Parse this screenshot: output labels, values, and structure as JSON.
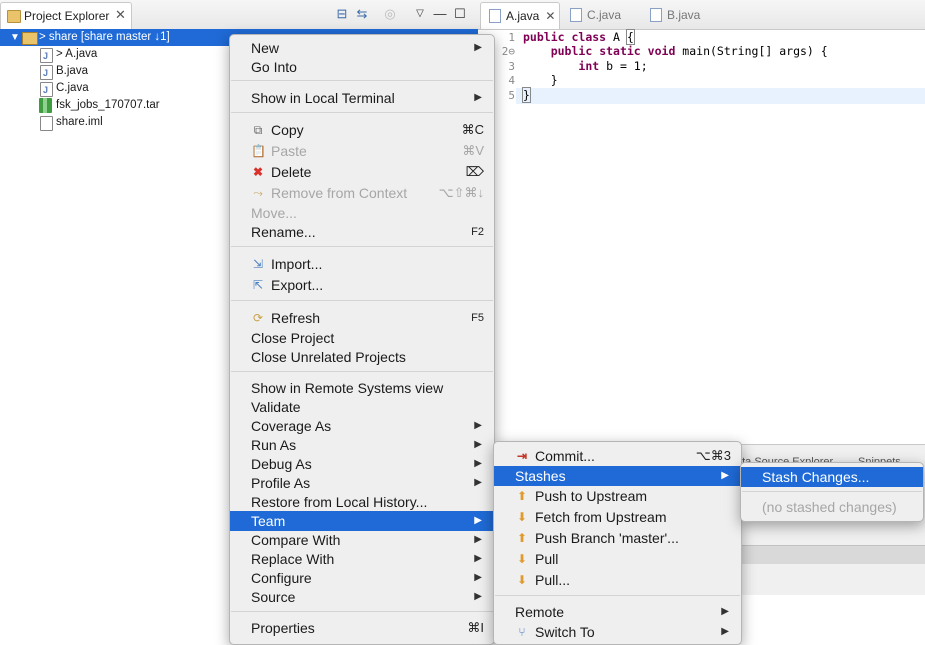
{
  "project_explorer": {
    "tab_title": "Project Explorer",
    "tree": [
      {
        "label": "> share [share master ↓1]",
        "type": "project"
      },
      {
        "label": "> A.java",
        "type": "java"
      },
      {
        "label": "B.java",
        "type": "java"
      },
      {
        "label": "C.java",
        "type": "java"
      },
      {
        "label": "fsk_jobs_170707.tar",
        "type": "tar"
      },
      {
        "label": "share.iml",
        "type": "file"
      }
    ]
  },
  "editor": {
    "tabs": [
      {
        "label": "A.java",
        "active": true
      },
      {
        "label": "C.java",
        "active": false
      },
      {
        "label": "B.java",
        "active": false
      }
    ],
    "line_numbers": [
      "1",
      "2⊖",
      "3",
      "4",
      "5"
    ],
    "bottom_tabs": [
      "ata Source Explorer",
      "Snippets"
    ]
  },
  "context_menu": {
    "items": [
      {
        "label": "New",
        "submenu": true
      },
      {
        "label": "Go Into"
      },
      {
        "label": "Show in Local Terminal",
        "submenu": true
      },
      {
        "label": "Copy",
        "shortcut": "⌘C",
        "icon": "copy-icon"
      },
      {
        "label": "Paste",
        "shortcut": "⌘V",
        "disabled": true,
        "icon": "paste-icon"
      },
      {
        "label": "Delete",
        "shortcut": "⌦",
        "icon": "delete-icon"
      },
      {
        "label": "Remove from Context",
        "shortcut": "⌥⇧⌘↓",
        "disabled": true,
        "icon": "remove-context-icon"
      },
      {
        "label": "Move...",
        "disabled": true
      },
      {
        "label": "Rename...",
        "shortcut": "F2"
      },
      {
        "label": "Import...",
        "icon": "import-icon"
      },
      {
        "label": "Export...",
        "icon": "export-icon"
      },
      {
        "label": "Refresh",
        "shortcut": "F5",
        "icon": "refresh-icon"
      },
      {
        "label": "Close Project"
      },
      {
        "label": "Close Unrelated Projects"
      },
      {
        "label": "Show in Remote Systems view"
      },
      {
        "label": "Validate"
      },
      {
        "label": "Coverage As",
        "submenu": true
      },
      {
        "label": "Run As",
        "submenu": true
      },
      {
        "label": "Debug As",
        "submenu": true
      },
      {
        "label": "Profile As",
        "submenu": true
      },
      {
        "label": "Restore from Local History..."
      },
      {
        "label": "Team",
        "submenu": true,
        "highlighted": true
      },
      {
        "label": "Compare With",
        "submenu": true
      },
      {
        "label": "Replace With",
        "submenu": true
      },
      {
        "label": "Configure",
        "submenu": true
      },
      {
        "label": "Source",
        "submenu": true
      },
      {
        "label": "Properties",
        "shortcut": "⌘I"
      }
    ]
  },
  "team_menu": {
    "items": [
      {
        "label": "Commit...",
        "shortcut": "⌥⌘3",
        "icon": "commit-icon"
      },
      {
        "label": "Stashes",
        "submenu": true,
        "highlighted": true
      },
      {
        "label": "Push to Upstream",
        "icon": "push-upstream-icon"
      },
      {
        "label": "Fetch from Upstream",
        "icon": "fetch-upstream-icon"
      },
      {
        "label": "Push Branch 'master'...",
        "icon": "push-branch-icon"
      },
      {
        "label": "Pull",
        "icon": "pull-icon"
      },
      {
        "label": "Pull...",
        "icon": "pull-dialog-icon"
      },
      {
        "label": "Remote",
        "submenu": true
      },
      {
        "label": "Switch To",
        "submenu": true,
        "icon": "switch-to-icon"
      }
    ]
  },
  "stashes_menu": {
    "items": [
      {
        "label": "Stash Changes...",
        "highlighted": true
      },
      {
        "label": "(no stashed changes)",
        "disabled": true
      }
    ]
  },
  "colors": {
    "selection": "#1f6ad6",
    "keyword": "#7f0055",
    "menu_bg": "#efefef"
  }
}
